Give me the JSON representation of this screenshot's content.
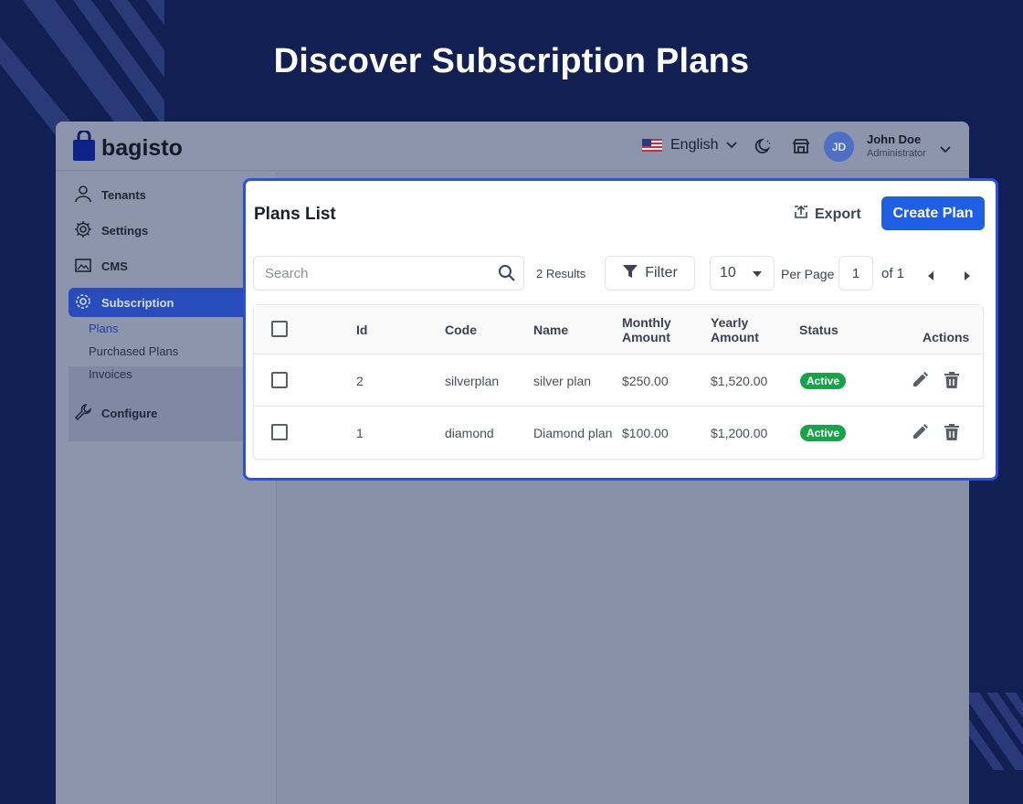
{
  "promo": {
    "title": "Discover Subscription Plans"
  },
  "header": {
    "logo_text": "bagisto",
    "language": "English",
    "user_initials": "JD",
    "user_name": "John Doe",
    "user_role": "Administrator"
  },
  "sidebar": {
    "items": [
      {
        "label": "Tenants",
        "icon": "user-icon"
      },
      {
        "label": "Settings",
        "icon": "gear-icon"
      },
      {
        "label": "CMS",
        "icon": "image-icon"
      },
      {
        "label": "Subscription",
        "icon": "subscription-gear-icon",
        "active": true
      },
      {
        "label": "Configure",
        "icon": "wrench-icon"
      }
    ],
    "sub_items": [
      "Plans",
      "Purchased Plans",
      "Invoices"
    ]
  },
  "plans": {
    "title": "Plans List",
    "export_label": "Export",
    "create_label": "Create Plan",
    "search_placeholder": "Search",
    "results": "2 Results",
    "filter_label": "Filter",
    "per_page_value": "10",
    "per_page_label": "Per Page",
    "page": "1",
    "of_label": "of 1",
    "columns": {
      "id": "Id",
      "code": "Code",
      "name": "Name",
      "monthly_1": "Monthly",
      "monthly_2": "Amount",
      "yearly_1": "Yearly",
      "yearly_2": "Amount",
      "status": "Status",
      "actions": "Actions"
    },
    "rows": [
      {
        "id": "2",
        "code": "silverplan",
        "name": "silver plan",
        "monthly": "$250.00",
        "yearly": "$1,520.00",
        "status": "Active"
      },
      {
        "id": "1",
        "code": "diamond",
        "name": "Diamond plan",
        "monthly": "$100.00",
        "yearly": "$1,200.00",
        "status": "Active"
      }
    ]
  },
  "colors": {
    "background": "#121f52",
    "accent": "#1f5fe6",
    "highlight_border": "#2b4fe0",
    "active_badge": "#17a34a"
  }
}
